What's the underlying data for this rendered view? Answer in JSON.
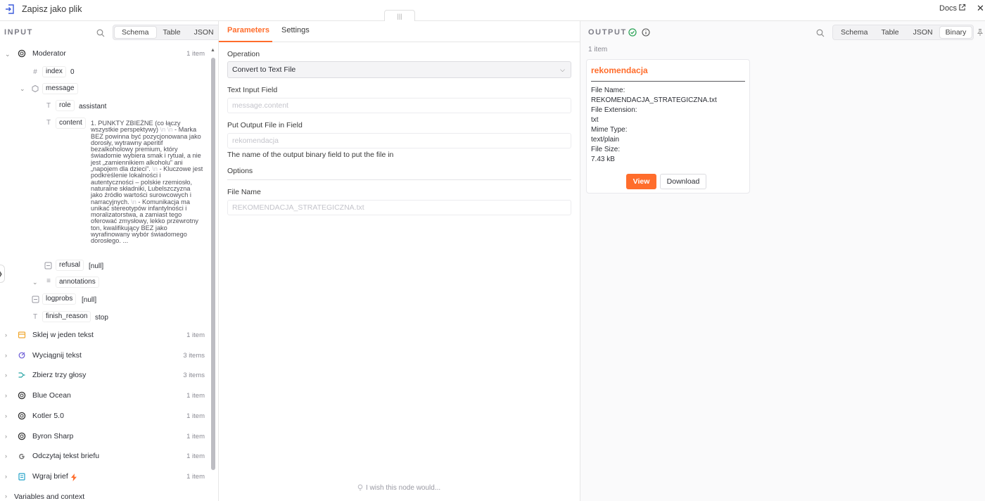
{
  "window": {
    "title": "Zapisz jako plik",
    "docs_label": "Docs",
    "close_glyph": "✕",
    "drag_handle_glyph": "|||"
  },
  "input": {
    "label": "INPUT",
    "view_options": [
      "Schema",
      "Table",
      "JSON"
    ],
    "active_view": "Schema",
    "nodes": [
      {
        "name": "Moderator",
        "items": "1 item",
        "icon": "openai-icon",
        "expanded": true
      },
      {
        "name": "Sklej w jeden tekst",
        "items": "1 item",
        "icon": "aggregate-icon"
      },
      {
        "name": "Wyciągnij tekst",
        "items": "3 items",
        "icon": "extract-icon"
      },
      {
        "name": "Zbierz trzy głosy",
        "items": "3 items",
        "icon": "merge-icon"
      },
      {
        "name": "Blue Ocean",
        "items": "1 item",
        "icon": "openai-icon"
      },
      {
        "name": "Kotler 5.0",
        "items": "1 item",
        "icon": "openai-icon"
      },
      {
        "name": "Byron Sharp",
        "items": "1 item",
        "icon": "openai-icon"
      },
      {
        "name": "Odczytaj tekst briefu",
        "items": "1 item",
        "icon": "google-icon"
      },
      {
        "name": "Wgraj brief",
        "items": "1 item",
        "icon": "trigger-icon",
        "badge": "lightning-icon"
      }
    ],
    "fields": {
      "index": {
        "key": "index",
        "value": "0"
      },
      "message": {
        "key": "message"
      },
      "role": {
        "key": "role",
        "value": "assistant"
      },
      "content": {
        "key": "content",
        "value_parts": [
          "1. PUNKTY ZBIEŻNE (co łączy wszystkie perspektywy)",
          " \\n \\n ",
          "- Marka BEZ powinna być pozycjonowana jako dorosły, wytrawny aperitif bezalkoholowy premium, który świadomie wybiera smak i rytuał, a nie jest „zamiennikiem alkoholu” ani „napojem dla dzieci”.",
          " \\n ",
          "- Kluczowe jest podkreślenie lokalności i autentyczności – polskie rzemiosło, naturalne składniki, Lubelszczyzna jako źródło wartości surowcowych i narracyjnych.",
          " \\n ",
          "- Komunikacja ma unikać stereotypów infantylności i moralizatorstwa, a zamiast tego oferować zmysłowy, lekko przewrotny ton, kwalifikujący BEZ jako wyrafinowany wybór świadomego dorosłego. ..."
        ]
      },
      "refusal": {
        "key": "refusal",
        "value": "[null]"
      },
      "annotations": {
        "key": "annotations"
      },
      "logprobs": {
        "key": "logprobs",
        "value": "[null]"
      },
      "finish_reason": {
        "key": "finish_reason",
        "value": "stop"
      }
    },
    "footer_label": "Variables and context"
  },
  "parameters": {
    "tabs": [
      "Parameters",
      "Settings"
    ],
    "active_tab": "Parameters",
    "operation_label": "Operation",
    "operation_value": "Convert to Text File",
    "text_input_label": "Text Input Field",
    "text_input_placeholder": "message.content",
    "output_field_label": "Put Output File in Field",
    "output_field_placeholder": "rekomendacja",
    "output_field_hint": "The name of the output binary field to put the file in",
    "options_label": "Options",
    "file_name_label": "File Name",
    "file_name_placeholder": "REKOMENDACJA_STRATEGICZNA.txt",
    "wish_text": "I wish this node would..."
  },
  "output": {
    "label": "OUTPUT",
    "view_options": [
      "Schema",
      "Table",
      "JSON",
      "Binary"
    ],
    "active_view": "Binary",
    "count": "1 item",
    "card": {
      "title": "rekomendacja",
      "file_name_label": "File Name:",
      "file_name_value": "REKOMENDACJA_STRATEGICZNA.txt",
      "file_ext_label": "File Extension:",
      "file_ext_value": "txt",
      "mime_label": "Mime Type:",
      "mime_value": "text/plain",
      "size_label": "File Size:",
      "size_value": "7.43 kB",
      "view_button": "View",
      "download_button": "Download"
    }
  },
  "colors": {
    "accent": "#ff6d2c",
    "success": "#2fa55a"
  }
}
